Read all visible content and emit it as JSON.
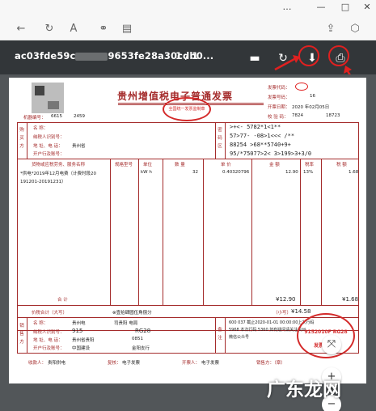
{
  "window": {
    "controls": [
      "…",
      "—",
      "□",
      "✕"
    ]
  },
  "browser_toolbar": {
    "back_icon": "←",
    "refresh_icon": "↻",
    "text_icon": "A",
    "link_icon": "⚭",
    "reader_icon": "▤",
    "share_icon": "⇪",
    "extensions_icon": "⬡"
  },
  "pdf_toolbar": {
    "file_name_start": "ac03fde59c",
    "file_name_end": "9653fe28a30cdb0...",
    "page_indicator": "1  /  1",
    "comment_icon": "▬",
    "rotate_icon": "↻",
    "download_icon": "⬇",
    "print_icon": "⎙",
    "highlight_color": "#e02020"
  },
  "invoice": {
    "title": "贵州增值税电子普通发票",
    "seal_title_text": "全国统一发票监制章",
    "machine_code_label": "机器编号：",
    "machine_code": "6615",
    "machine_code_tail": "2459",
    "invoice_code_label": "发票代码：",
    "invoice_no_label": "发票号码：",
    "invoice_no_tail": "16",
    "issue_date_label": "开票日期：",
    "issue_date": "2020 年02月05日",
    "check_code_label": "校 验 码：",
    "check_code_start": "7824",
    "check_code_end": "18723",
    "buyer_side": [
      "购",
      "买",
      "方"
    ],
    "buyer_name_label": "名    称：",
    "buyer_tax_label": "纳税人识别号：",
    "buyer_addr_label": "地 址、电 话：",
    "buyer_addr_value": "贵州省",
    "buyer_bank_label": "开户行及账号：",
    "cipher_side": [
      "密",
      "码",
      "区"
    ],
    "cipher_lines": [
      ">+<-             5782*1<1**",
      "57>77-   -08>1<<<   /**",
      "88254             >68**5740+9+",
      "95/*75077>2<      3>199>3+3/0"
    ],
    "goods_header": [
      "货物或应税劳务、服务名称",
      "规格型号",
      "单位",
      "数 量",
      "单 价",
      "金 额",
      "税率",
      "税 额"
    ],
    "goods_name_line1": "*供电*2019年12月电费（计费时段20",
    "goods_name_line2": "191201-20191231）",
    "goods_unit": "kW h",
    "goods_qty": "32",
    "goods_price": "0.40320796",
    "goods_amount": "12.90",
    "goods_rate": "13%",
    "goods_tax": "1.68",
    "total_label": "合          计",
    "total_amount": "¥12.90",
    "total_tax": "¥1.68",
    "total_words_label": "价税合计（大写）",
    "total_words": "⊗壹拾肆圆伍角捌分",
    "total_small_label": "（小写）",
    "total_small": "¥14.58",
    "seller_side": [
      "销",
      "售",
      "方"
    ],
    "seller_name_label": "名    称：",
    "seller_name_value": "贵州电",
    "seller_name_tail": "司贵阳   电局",
    "seller_tax_label": "纳税人识别号：",
    "seller_tax_start": "915",
    "seller_tax_end": "RG28",
    "seller_addr_label": "地 址、电 话：",
    "seller_addr_value": "贵州省贵阳",
    "seller_addr_tail": "0851",
    "seller_bank_label": "开户行及账号：",
    "seller_bank_value": "中国建设",
    "seller_bank_tail": "金阳支行",
    "remarks_side": [
      "备",
      "注"
    ],
    "remark_line1": "600            037 截止2020-01-01 00:00:00上次行码",
    "remark_line2": "5968 本次行码 5360 如有疑问请关注贵州",
    "remark_line3": "微信公众号",
    "payee_label": "收款人：",
    "payee_value": "贵阳供电",
    "reviewer_label": "复核：",
    "reviewer_value": "电子发票",
    "drawer_label": "开票人：",
    "drawer_value": "电子发票",
    "seller_stamp_label": "销售方：（章）",
    "seller_seal_text": "发票专用章",
    "seller_seal_code": "9152010F RG28",
    "accent_red": "#a42b2b"
  },
  "zoom": {
    "fit_icon": "⤧",
    "zoom_in": "+",
    "zoom_out": "−"
  },
  "watermark": "广东龙网"
}
